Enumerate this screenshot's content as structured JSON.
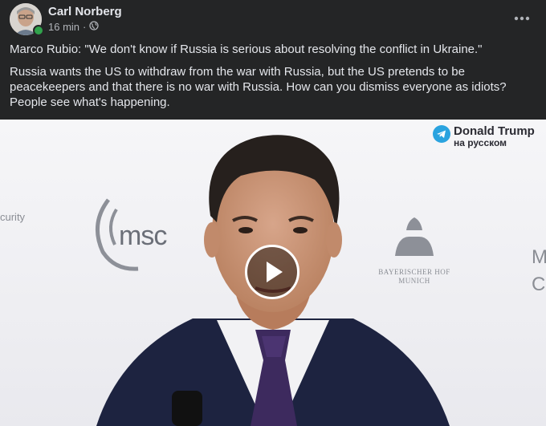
{
  "post": {
    "author": "Carl Norberg",
    "time": "16 min",
    "separator": "·",
    "more_icon": "more-horizontal-icon",
    "visibility_icon": "globe-icon",
    "online_color": "#31a24c",
    "line1": "Marco Rubio: \"We don't know if Russia is serious about resolving the conflict in Ukraine.\"",
    "line2": "Russia wants the US to withdraw from the war with Russia, but the US pretends to be peacekeepers and that there is no war with Russia. How can you dismiss everyone as idiots? People see what's happening."
  },
  "video": {
    "watermark_title": "Donald Trump",
    "watermark_subtitle": "на русском",
    "backdrop_logo": "msc",
    "backdrop_left_text": "curity",
    "backdrop_right_text": "Mu Co",
    "backdrop_hof_text": "BAYERISCHER HOF MUNICH",
    "play_icon": "play-icon"
  }
}
